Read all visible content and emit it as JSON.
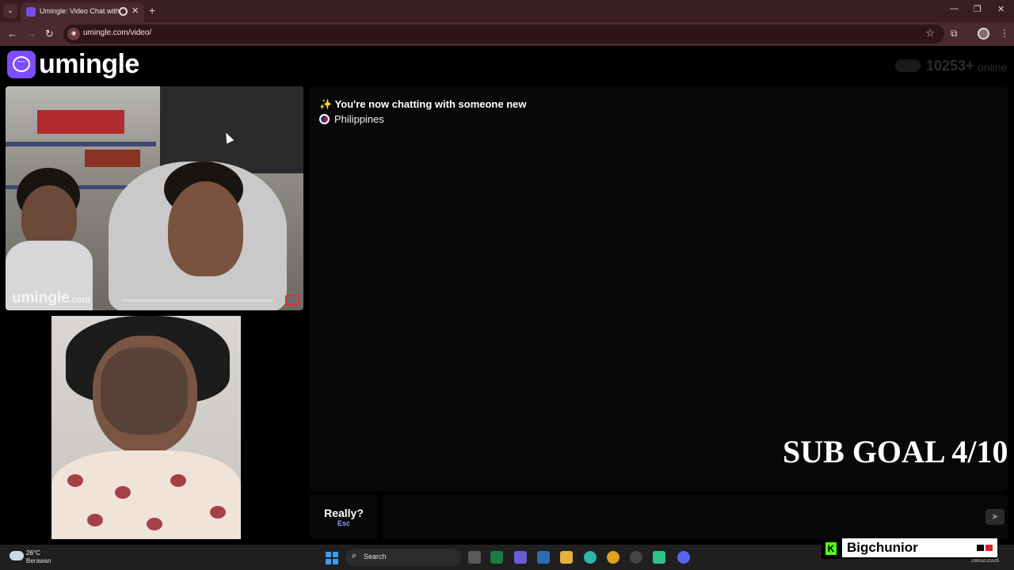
{
  "browser": {
    "tab_title": "Umingle: Video Chat with S",
    "url": "umingle.com/video/",
    "tab_list_icon": "chevron-down-icon",
    "new_tab_icon": "plus-icon"
  },
  "site": {
    "logo_text": "umingle",
    "online_count": "10253+",
    "online_label": "online",
    "brand_color": "#7c4dff"
  },
  "stranger_video": {
    "watermark": "umingle",
    "watermark_suffix": ".com"
  },
  "chat": {
    "messages": [
      {
        "text": "✨ You're now chatting with someone new",
        "icon": "sparkle-icon"
      },
      {
        "text": "Philippines",
        "icon": "philippines-flag-icon"
      }
    ]
  },
  "overlay": {
    "sub_goal": "SUB GOAL 4/10"
  },
  "controls": {
    "skip_label": "Really?",
    "skip_hint": "Esc",
    "message_placeholder": "",
    "send_icon": "send-icon"
  },
  "taskbar": {
    "weather_temp": "26°C",
    "weather_desc": "Berawan",
    "search_label": "Search",
    "date": "28/02/2026"
  },
  "stream_overlay": {
    "streamer_name": "Bigchunior",
    "platform_logo": "K"
  }
}
